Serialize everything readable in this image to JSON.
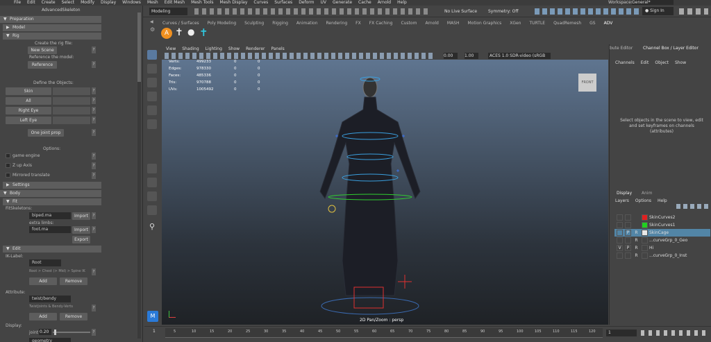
{
  "menu": [
    "File",
    "Edit",
    "Create",
    "Select",
    "Modify",
    "Display",
    "Windows",
    "Mesh",
    "Edit Mesh",
    "Mesh Tools",
    "Mesh Display",
    "Curves",
    "Surfaces",
    "Deform",
    "UV",
    "Generate",
    "Cache",
    "Arnold",
    "Help"
  ],
  "workspace_label": "Workspace:",
  "workspace_value": "General*",
  "status": {
    "mode": "Modeling",
    "live": "No Live Surface",
    "symmetry": "Symmetry: Off",
    "signin": "Sign In"
  },
  "shelf_tabs": [
    "Curves / Surfaces",
    "Poly Modeling",
    "Sculpting",
    "Rigging",
    "Animation",
    "Rendering",
    "FX",
    "FX Caching",
    "Custom",
    "Arnold",
    "MASH",
    "Motion Graphics",
    "XGen",
    "TURTLE",
    "QuadRemesh",
    "GS",
    "ADV"
  ],
  "left": {
    "title": "AdvancedSkeleton",
    "preparation": "Preparation",
    "model": "Model",
    "rig": "Rig",
    "create_rig_file": "Create the rig file:",
    "new_scene": "New Scene",
    "reference_model": "Reference the model:",
    "reference": "Reference",
    "define_objects": "Define the Objects:",
    "skin": "Skin",
    "all": "All",
    "right_eye": "Right Eye",
    "left_eye": "Left Eye",
    "one_joint_prop": "One joint prop",
    "options": "Options:",
    "game_engine": "game engine",
    "z_up": "Z up Axis",
    "mirrored": "Mirrored translate",
    "settings": "Settings",
    "body": "Body",
    "fit": "Fit",
    "fitskeletons": "FitSkeletons:",
    "biped": "biped.ma",
    "import": "Import",
    "extra_limbs": "extra limbs:",
    "foot": "foot.ma",
    "import2": "Import",
    "export": "Export",
    "edit": "Edit",
    "iklabel": "IK-Label:",
    "root": "Root",
    "root_hint": "Root > Chest (> Mid) > Spine IK",
    "add": "Add",
    "remove": "Remove",
    "attribute": "Attribute:",
    "twist": "twist/bendy",
    "twist_hint": "TwistJoints & Bendy-Verts",
    "add2": "Add",
    "remove2": "Remove",
    "display": "Display:",
    "joint": "joint",
    "joint_val": "0.20",
    "geometry": "geometry"
  },
  "viewport": {
    "menu": [
      "View",
      "Shading",
      "Lighting",
      "Show",
      "Renderer",
      "Panels"
    ],
    "val1": "0.00",
    "val2": "1.00",
    "colorspace": "ACES 1.0 SDR-video (sRGB",
    "stats": [
      [
        "Verts:",
        "499233",
        "0",
        "0"
      ],
      [
        "Edges:",
        "978330",
        "0",
        "0"
      ],
      [
        "Faces:",
        "485336",
        "0",
        "0"
      ],
      [
        "Tris:",
        "970788",
        "0",
        "0"
      ],
      [
        "UVs:",
        "1005492",
        "0",
        "0"
      ]
    ],
    "cube": "FRONT",
    "camera": "2D Pan/Zoom : persp"
  },
  "right": {
    "tab1": "bute Editor",
    "tab2": "Channel Box / Layer Editor",
    "menu": [
      "Channels",
      "Edit",
      "Object",
      "Show"
    ],
    "message": "Select objects in the scene to view, edit and set keyframes on channels (attributes)",
    "disp_tab": "Display",
    "anim_tab": "Anim",
    "layer_menu": [
      "Layers",
      "Options",
      "Help"
    ],
    "layers": [
      {
        "v": "",
        "p": "",
        "r": "",
        "color": "#e02020",
        "name": "SkinCurves2"
      },
      {
        "v": "",
        "p": "",
        "r": "",
        "color": "#20d020",
        "name": "SkinCurves1"
      },
      {
        "v": "",
        "p": "P",
        "r": "R",
        "color": "#e8e8e8",
        "name": "SkinCage",
        "selected": true
      },
      {
        "v": "",
        "p": "",
        "r": "R",
        "color": "",
        "name": "...curveGrp_0_Geo"
      },
      {
        "v": "V",
        "p": "P",
        "r": "R",
        "color": "",
        "name": "Hi"
      },
      {
        "v": "",
        "p": "",
        "r": "R",
        "color": "",
        "name": "...curveGrp_0_Inst"
      }
    ]
  },
  "timeline": {
    "ticks": [
      "5",
      "10",
      "15",
      "20",
      "25",
      "30",
      "35",
      "40",
      "45",
      "50",
      "55",
      "60",
      "65",
      "70",
      "75",
      "80",
      "85",
      "90",
      "95",
      "100",
      "105",
      "110",
      "115",
      "120"
    ],
    "first": "1",
    "current": "1"
  }
}
